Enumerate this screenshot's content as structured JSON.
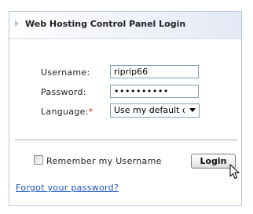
{
  "header": {
    "title": "Web Hosting Control Panel Login"
  },
  "form": {
    "username_label": "Username:",
    "username_value": "riprip66",
    "password_label": "Password:",
    "password_value": "••••••••••",
    "language_label": "Language:",
    "language_required_marker": "*",
    "language_value": "Use my default c"
  },
  "options": {
    "remember_label": "Remember my Username",
    "remember_checked": false,
    "login_label": "Login"
  },
  "links": {
    "forgot_password": "Forgot your password?"
  },
  "colors": {
    "accent_link": "#1a4fc4",
    "required_marker": "#e02020",
    "panel_border": "#b9c4d9"
  },
  "icons": {
    "header_arrow": "triangle-right",
    "select_arrow": "triangle-down",
    "cursor": "mouse-pointer"
  }
}
